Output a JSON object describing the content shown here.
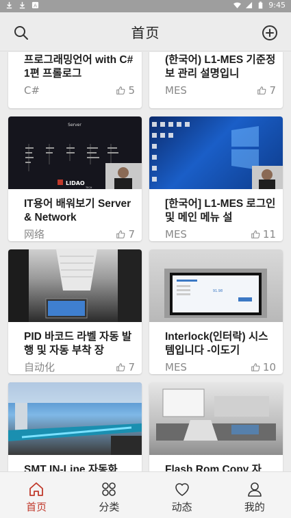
{
  "status_bar": {
    "time": "9:45"
  },
  "header": {
    "title": "首页",
    "search_icon": "search-icon",
    "add_icon": "add-circle-icon"
  },
  "videos": [
    {
      "title": "프로그래밍언어 with C# 1편 프롤로그",
      "category": "C#",
      "likes": "5"
    },
    {
      "title": "(한국어) L1-MES 기준정보 관리 설명입니",
      "category": "MES",
      "likes": "7"
    },
    {
      "title": "IT용어 배워보기 Server & Network",
      "category": "网络",
      "likes": "7",
      "thumb_text": {
        "heading": "Server",
        "logo": "LIDAO",
        "logo_sub": "TECH"
      }
    },
    {
      "title": "[한국어] L1-MES 로그인 및 메인 메뉴 설",
      "category": "MES",
      "likes": "11"
    },
    {
      "title": "PID 바코드 라벨 자동 발행 및 자동 부착 장",
      "category": "自动化",
      "likes": "7"
    },
    {
      "title": "Interlock(인터락) 시스템입니다 -이도기",
      "category": "MES",
      "likes": "10",
      "thumb_text": {
        "screen": "91.98"
      }
    },
    {
      "title": "SMT IN-Line 자동화",
      "category": "",
      "likes": ""
    },
    {
      "title": "Flash Rom Copy 자",
      "category": "",
      "likes": ""
    }
  ],
  "bottom_nav": [
    {
      "label": "首页",
      "icon": "home-icon",
      "active": true
    },
    {
      "label": "分类",
      "icon": "category-icon",
      "active": false
    },
    {
      "label": "动态",
      "icon": "heart-icon",
      "active": false
    },
    {
      "label": "我的",
      "icon": "profile-icon",
      "active": false
    }
  ],
  "colors": {
    "accent": "#c0392b",
    "background": "#ececec",
    "card": "#ffffff"
  }
}
